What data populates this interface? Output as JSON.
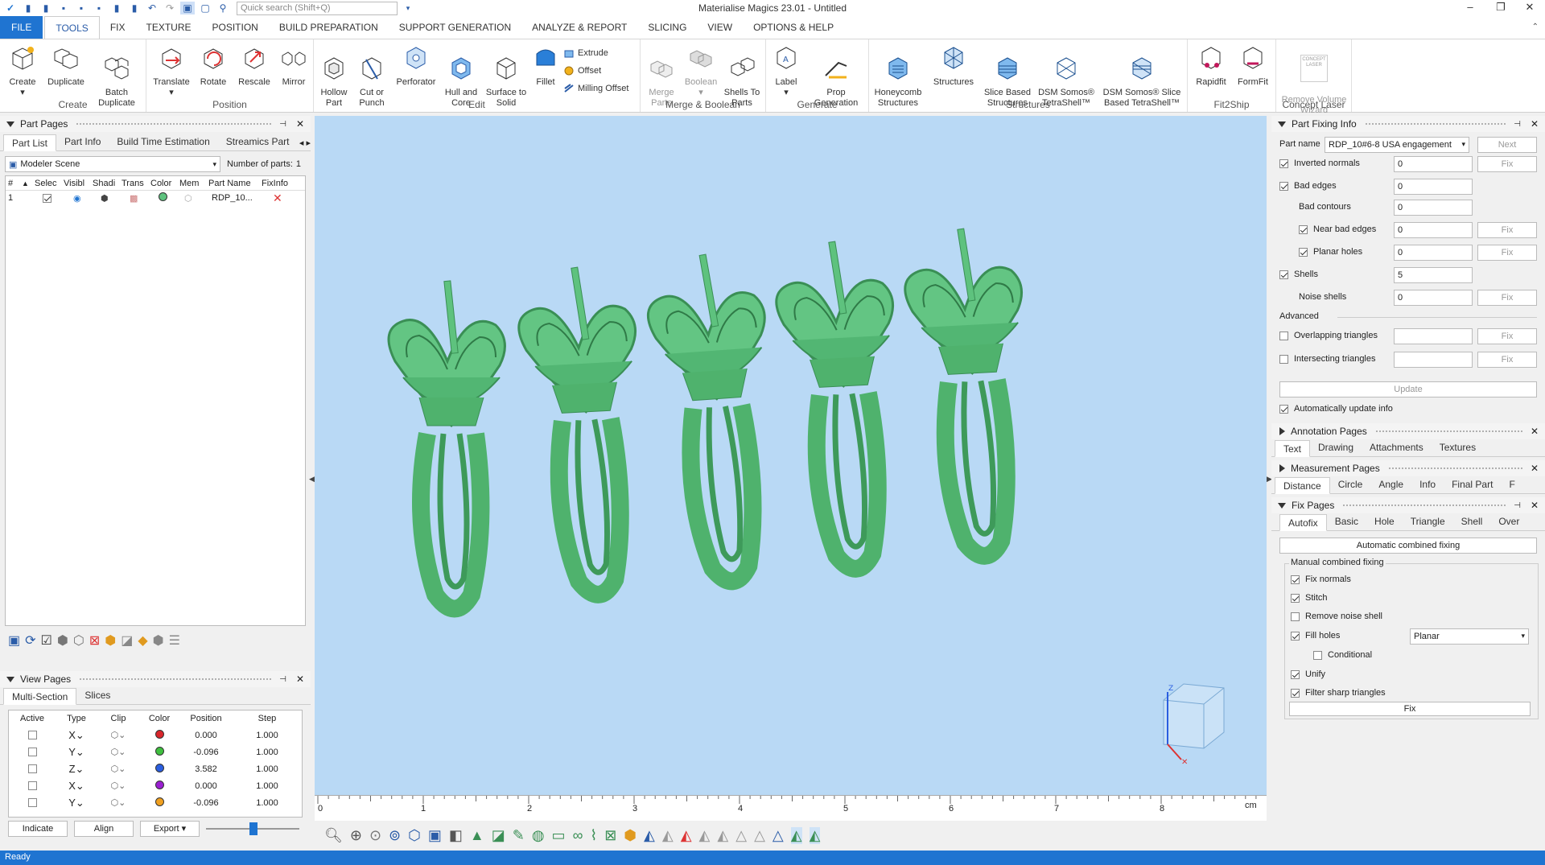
{
  "app": {
    "title": "Materialise Magics 23.01 - Untitled"
  },
  "search": {
    "placeholder": "Quick search (Shift+Q)"
  },
  "menu": [
    "FILE",
    "TOOLS",
    "FIX",
    "TEXTURE",
    "POSITION",
    "BUILD PREPARATION",
    "SUPPORT GENERATION",
    "ANALYZE & REPORT",
    "SLICING",
    "VIEW",
    "OPTIONS & HELP"
  ],
  "ribbon": {
    "groups": [
      "Create",
      "Position",
      "Edit",
      "Merge & Boolean",
      "Generate",
      "Structures",
      "Fit2Ship",
      "Concept Laser"
    ],
    "tools": {
      "create": "Create",
      "duplicate": "Duplicate",
      "batch_duplicate": "Batch\nDuplicate",
      "translate": "Translate",
      "rotate": "Rotate",
      "rescale": "Rescale",
      "mirror": "Mirror",
      "hollow": "Hollow\nPart",
      "cut": "Cut or\nPunch",
      "perforator": "Perforator",
      "hull": "Hull and\nCore",
      "surface": "Surface to\nSolid",
      "fillet": "Fillet",
      "extrude": "Extrude",
      "offset": "Offset",
      "milling": "Milling Offset",
      "merge": "Merge\nParts",
      "boolean": "Boolean",
      "shells": "Shells To\nParts",
      "label": "Label",
      "prop": "Prop\nGeneration",
      "honeycomb": "Honeycomb\nStructures",
      "structures": "Structures",
      "slice_based": "Slice Based\nStructures",
      "dsm1": "DSM Somos®\nTetraShell™",
      "dsm2": "DSM Somos® Slice\nBased TetraShell™",
      "rapidfit": "Rapidfit",
      "formfit": "FormFit",
      "remove_volume": "Remove Volume\nWizard",
      "concept_badge": "CONCEPT\nLASER"
    }
  },
  "part_pages": {
    "title": "Part Pages",
    "tabs": [
      "Part List",
      "Part Info",
      "Build Time Estimation",
      "Streamics Part"
    ],
    "scene": "Modeler Scene",
    "num_parts_label": "Number of parts:",
    "num_parts": "1",
    "columns": [
      "#",
      "Selec",
      "Visibl",
      "Shadi",
      "Trans",
      "Color",
      "Mem",
      "Part Name",
      "FixInfo"
    ],
    "rows": [
      {
        "num": "1",
        "name": "RDP_10..."
      }
    ]
  },
  "view_pages": {
    "title": "View Pages",
    "tabs": [
      "Multi-Section",
      "Slices"
    ],
    "columns": [
      "Active",
      "Type",
      "Clip",
      "Color",
      "Position",
      "Step"
    ],
    "rows": [
      {
        "type": "X",
        "color": "#d9262b",
        "position": "0.000",
        "step": "1.000"
      },
      {
        "type": "Y",
        "color": "#3fbf3f",
        "position": "-0.096",
        "step": "1.000"
      },
      {
        "type": "Z",
        "color": "#2a5ee0",
        "position": "3.582",
        "step": "1.000"
      },
      {
        "type": "X",
        "color": "#9a1fd1",
        "position": "0.000",
        "step": "1.000"
      },
      {
        "type": "Y",
        "color": "#f0a020",
        "position": "-0.096",
        "step": "1.000"
      }
    ],
    "buttons": {
      "indicate": "Indicate",
      "align": "Align",
      "export": "Export"
    }
  },
  "fixing_info": {
    "title": "Part Fixing Info",
    "part_name_label": "Part name",
    "part_name": "RDP_10#6-8 USA engagement",
    "next": "Next",
    "fix": "Fix",
    "rows": {
      "inverted": {
        "label": "Inverted normals",
        "value": "0"
      },
      "bad_edges": {
        "label": "Bad edges",
        "value": "0"
      },
      "bad_contours": {
        "label": "Bad contours",
        "value": "0"
      },
      "near_bad": {
        "label": "Near bad edges",
        "value": "0"
      },
      "planar": {
        "label": "Planar holes",
        "value": "0"
      },
      "shells": {
        "label": "Shells",
        "value": "5"
      },
      "noise": {
        "label": "Noise shells",
        "value": "0"
      },
      "overlap": {
        "label": "Overlapping triangles",
        "value": ""
      },
      "intersect": {
        "label": "Intersecting triangles",
        "value": ""
      }
    },
    "advanced": "Advanced",
    "update": "Update",
    "auto_update": "Automatically update info"
  },
  "annotation_pages": {
    "title": "Annotation Pages",
    "tabs": [
      "Text",
      "Drawing",
      "Attachments",
      "Textures"
    ]
  },
  "measurement_pages": {
    "title": "Measurement Pages",
    "tabs": [
      "Distance",
      "Circle",
      "Angle",
      "Info",
      "Final Part",
      "F"
    ]
  },
  "fix_pages": {
    "title": "Fix Pages",
    "tabs": [
      "Autofix",
      "Basic",
      "Hole",
      "Triangle",
      "Shell",
      "Over"
    ],
    "auto_button": "Automatic combined fixing",
    "manual_legend": "Manual combined fixing",
    "options": {
      "fix_normals": "Fix normals",
      "stitch": "Stitch",
      "remove_noise": "Remove noise shell",
      "fill_holes": "Fill holes",
      "conditional": "Conditional",
      "unify": "Unify",
      "filter_sharp": "Filter sharp triangles"
    },
    "fill_mode": "Planar",
    "fix_button": "Fix"
  },
  "ruler": {
    "ticks": [
      "0",
      "1",
      "2",
      "3",
      "4",
      "5",
      "6",
      "7",
      "8"
    ],
    "unit": "cm"
  },
  "status": "Ready",
  "colors": {
    "accent": "#1f74d1",
    "viewport": "#b9d9f5",
    "model": "#5ec27e"
  }
}
